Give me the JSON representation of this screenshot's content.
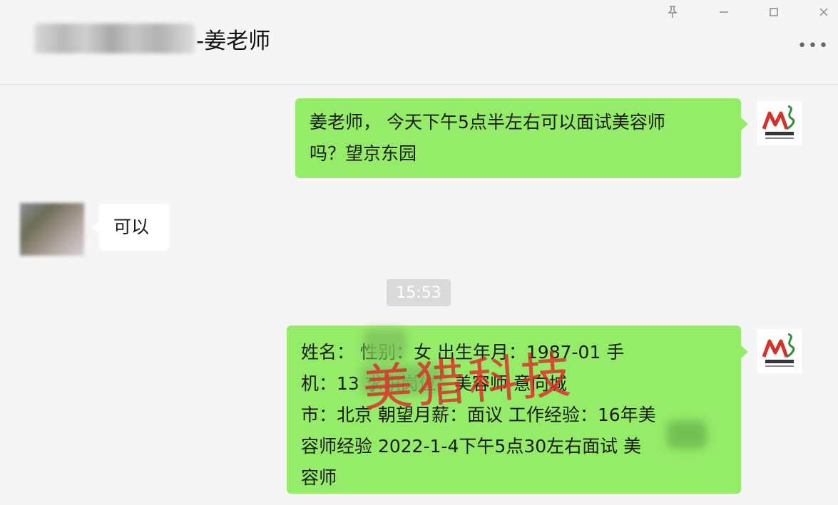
{
  "header": {
    "title_suffix": "-姜老师",
    "window_controls": {
      "pin_icon": "pin-icon",
      "minimize_icon": "minimize-icon",
      "maximize_icon": "maximize-icon",
      "close_icon": "close-icon"
    },
    "more_icon": "more-icon"
  },
  "messages": [
    {
      "from": "me",
      "text_line1": "姜老师， 今天下午5点半左右可以面试美容师",
      "text_line2": "吗？望京东园"
    },
    {
      "from": "other",
      "text": "可以"
    },
    {
      "timestamp": "15:53"
    },
    {
      "from": "me",
      "lines": [
        "姓名：       性别：女 出生年月：1987-01 手",
        "机：13           求职岗位：美容师 意向城",
        "市：北京 朝望月薪：面议 工作经验：16年美",
        "容师经验 2022-1-4下午5点30左右面试       美",
        "容师"
      ]
    }
  ],
  "watermark": "美猎科技",
  "colors": {
    "my_bubble": "#95ec69",
    "other_bubble": "#ffffff",
    "background": "#f5f5f5",
    "watermark": "#e12828"
  }
}
